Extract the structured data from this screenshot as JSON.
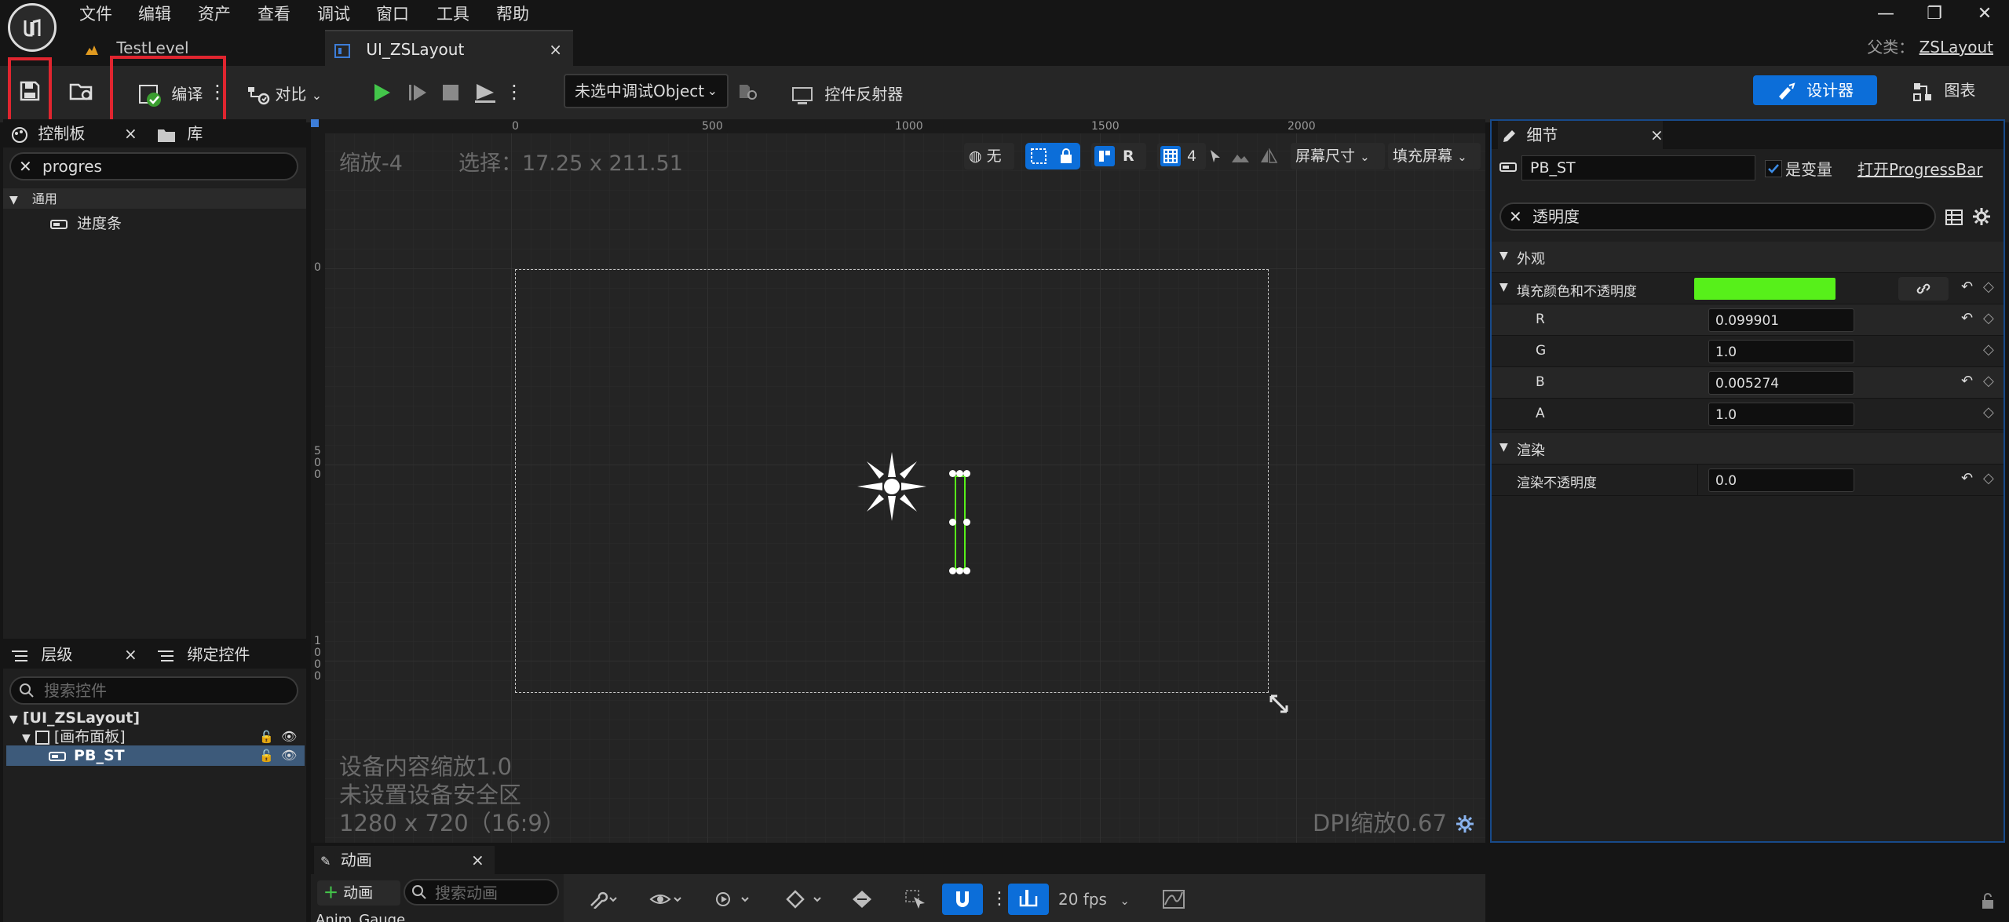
{
  "menu": {
    "items": [
      "文件",
      "编辑",
      "资产",
      "查看",
      "调试",
      "窗口",
      "工具",
      "帮助"
    ]
  },
  "window_controls": {
    "minimize": "—",
    "restore": "❐",
    "close": "✕"
  },
  "doc_tabs": {
    "tab1": "TestLevel",
    "tab2": "UI_ZSLayout",
    "tab2_close": "×"
  },
  "parent": {
    "label": "父类：",
    "value": "ZSLayout"
  },
  "toolbar": {
    "compile_label": "编译",
    "diff_label": "对比",
    "debug_object": "未选中调试Object",
    "widget_reflector": "控件反射器",
    "designer": "设计器",
    "graph": "图表"
  },
  "palette": {
    "tab_label": "控制板",
    "library_label": "库",
    "close": "×",
    "search_value": "progres",
    "category": "通用",
    "items": [
      "进度条"
    ]
  },
  "hierarchy": {
    "tab_label": "层级",
    "bind_label": "绑定控件",
    "close": "×",
    "search_placeholder": "搜索控件",
    "rows": [
      "[UI_ZSLayout]",
      "[画布面板]",
      "PB_ST"
    ]
  },
  "viewport": {
    "zoom": "缩放-4",
    "selection": "选择：17.25 x 211.51",
    "ruler_top": [
      "0",
      "500",
      "1000",
      "1500",
      "2000"
    ],
    "ruler_left": [
      "0",
      "5\n0\n0",
      "1\n0\n0\n0"
    ],
    "toolbar": {
      "none_label": "无",
      "r_label": "R",
      "grid_num": "4",
      "screen_size": "屏幕尺寸",
      "fill_screen": "填充屏幕"
    },
    "device_scale": "设备内容缩放1.0",
    "safe_zone": "未设置设备安全区",
    "resolution": "1280 x 720（16:9）",
    "dpi": "DPI缩放0.67"
  },
  "details": {
    "tab_label": "细节",
    "close": "×",
    "name_value": "PB_ST",
    "is_variable": "是变量",
    "open_link": "打开ProgressBar",
    "search_value": "透明度",
    "sections": {
      "appearance": "外观",
      "fill_color": "填充颜色和不透明度",
      "fill_color_hex": "#57f01a",
      "channels": [
        {
          "name": "R",
          "value": "0.099901"
        },
        {
          "name": "G",
          "value": "1.0"
        },
        {
          "name": "B",
          "value": "0.005274"
        },
        {
          "name": "A",
          "value": "1.0"
        }
      ],
      "render": "渲染",
      "render_opacity_label": "渲染不透明度",
      "render_opacity_value": "0.0"
    }
  },
  "animation": {
    "tab_label": "动画",
    "close": "×",
    "add_label": "动画",
    "search_placeholder": "搜索动画",
    "item": "Anim_Gauge",
    "fps": "20 fps"
  },
  "colors": {
    "accent": "#0c6ed9",
    "highlight_red": "#e0252f",
    "progress_green": "#57f01a"
  }
}
